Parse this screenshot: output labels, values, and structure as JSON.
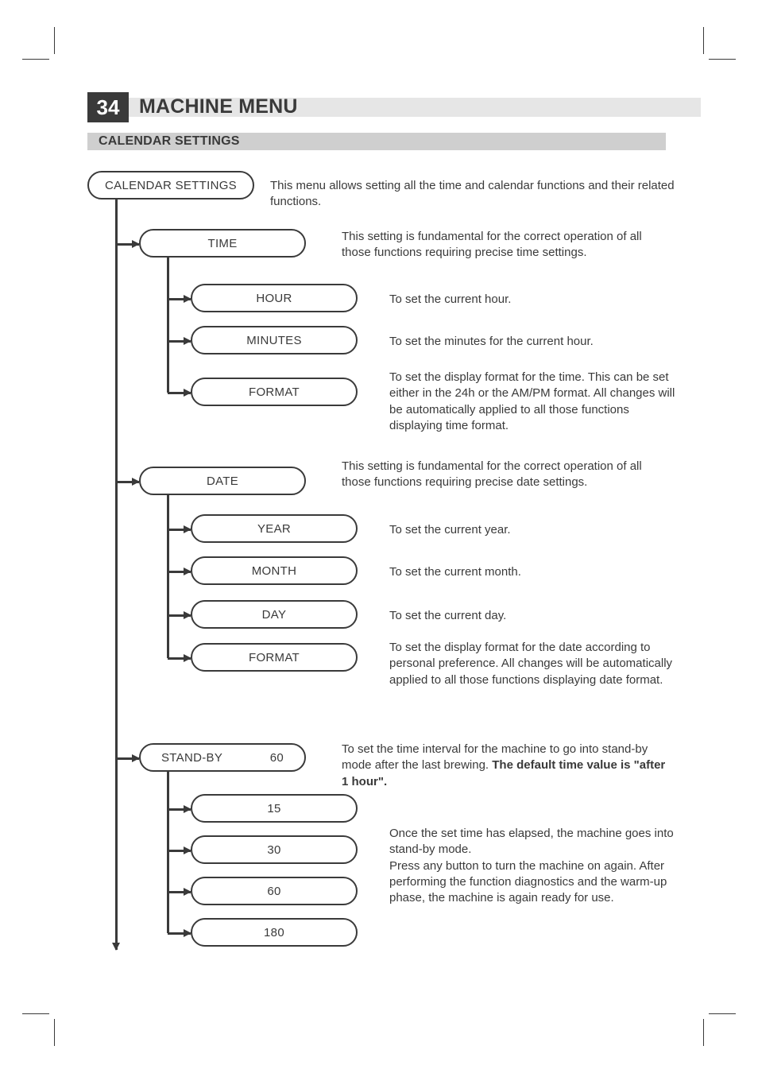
{
  "page_number": "34",
  "page_title": "MACHINE MENU",
  "section_title": "CALENDAR SETTINGS",
  "root": {
    "label": "CALENDAR SETTINGS",
    "desc": "This menu allows setting all the time and calendar functions and their related functions."
  },
  "time": {
    "label": "TIME",
    "desc": "This setting is fundamental for the correct operation of all those functions requiring precise time settings.",
    "items": {
      "hour": {
        "label": "HOUR",
        "desc": "To set the current hour."
      },
      "minutes": {
        "label": "MINUTES",
        "desc": "To set the minutes for the current hour."
      },
      "format": {
        "label": "FORMAT",
        "desc": "To set the display format for the time. This can be set either in the 24h or the AM/PM format. All changes will be automatically applied to all those functions displaying time format."
      }
    }
  },
  "date": {
    "label": "DATE",
    "desc": "This setting is fundamental for the correct operation of all those functions requiring precise date settings.",
    "items": {
      "year": {
        "label": "YEAR",
        "desc": "To set the current year."
      },
      "month": {
        "label": "MONTH",
        "desc": "To set the current month."
      },
      "day": {
        "label": "DAY",
        "desc": "To set the current day."
      },
      "format": {
        "label": "FORMAT",
        "desc": "To set the display format for the date according to personal preference. All changes will be automatically applied to all those functions displaying date format."
      }
    }
  },
  "standby": {
    "label": "STAND-BY",
    "value": "60",
    "desc_prefix": "To set the time interval for the machine to go into stand-by mode after the last brewing. ",
    "desc_bold": "The default time value is \"after 1 hour\".",
    "options": {
      "o15": "15",
      "o30": "30",
      "o60": "60",
      "o180": "180"
    },
    "options_desc": "Once the set time has elapsed, the machine goes into stand-by mode.\nPress any button to turn the machine on again. After performing the function diagnostics and the warm-up phase, the machine is again ready for use."
  }
}
